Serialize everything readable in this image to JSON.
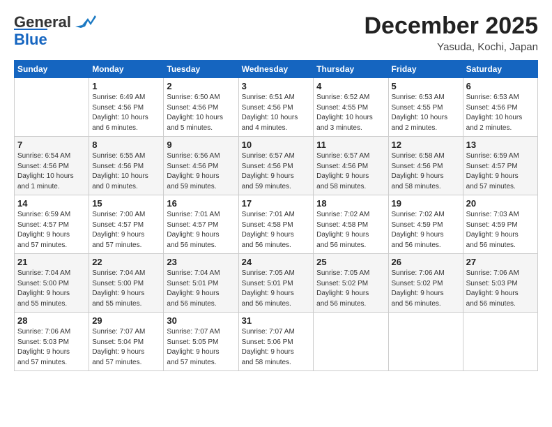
{
  "logo": {
    "line1": "General",
    "line2": "Blue"
  },
  "header": {
    "month": "December 2025",
    "location": "Yasuda, Kochi, Japan"
  },
  "weekdays": [
    "Sunday",
    "Monday",
    "Tuesday",
    "Wednesday",
    "Thursday",
    "Friday",
    "Saturday"
  ],
  "weeks": [
    [
      {
        "day": "",
        "info": ""
      },
      {
        "day": "1",
        "info": "Sunrise: 6:49 AM\nSunset: 4:56 PM\nDaylight: 10 hours\nand 6 minutes."
      },
      {
        "day": "2",
        "info": "Sunrise: 6:50 AM\nSunset: 4:56 PM\nDaylight: 10 hours\nand 5 minutes."
      },
      {
        "day": "3",
        "info": "Sunrise: 6:51 AM\nSunset: 4:56 PM\nDaylight: 10 hours\nand 4 minutes."
      },
      {
        "day": "4",
        "info": "Sunrise: 6:52 AM\nSunset: 4:55 PM\nDaylight: 10 hours\nand 3 minutes."
      },
      {
        "day": "5",
        "info": "Sunrise: 6:53 AM\nSunset: 4:55 PM\nDaylight: 10 hours\nand 2 minutes."
      },
      {
        "day": "6",
        "info": "Sunrise: 6:53 AM\nSunset: 4:56 PM\nDaylight: 10 hours\nand 2 minutes."
      }
    ],
    [
      {
        "day": "7",
        "info": "Sunrise: 6:54 AM\nSunset: 4:56 PM\nDaylight: 10 hours\nand 1 minute."
      },
      {
        "day": "8",
        "info": "Sunrise: 6:55 AM\nSunset: 4:56 PM\nDaylight: 10 hours\nand 0 minutes."
      },
      {
        "day": "9",
        "info": "Sunrise: 6:56 AM\nSunset: 4:56 PM\nDaylight: 9 hours\nand 59 minutes."
      },
      {
        "day": "10",
        "info": "Sunrise: 6:57 AM\nSunset: 4:56 PM\nDaylight: 9 hours\nand 59 minutes."
      },
      {
        "day": "11",
        "info": "Sunrise: 6:57 AM\nSunset: 4:56 PM\nDaylight: 9 hours\nand 58 minutes."
      },
      {
        "day": "12",
        "info": "Sunrise: 6:58 AM\nSunset: 4:56 PM\nDaylight: 9 hours\nand 58 minutes."
      },
      {
        "day": "13",
        "info": "Sunrise: 6:59 AM\nSunset: 4:57 PM\nDaylight: 9 hours\nand 57 minutes."
      }
    ],
    [
      {
        "day": "14",
        "info": "Sunrise: 6:59 AM\nSunset: 4:57 PM\nDaylight: 9 hours\nand 57 minutes."
      },
      {
        "day": "15",
        "info": "Sunrise: 7:00 AM\nSunset: 4:57 PM\nDaylight: 9 hours\nand 57 minutes."
      },
      {
        "day": "16",
        "info": "Sunrise: 7:01 AM\nSunset: 4:57 PM\nDaylight: 9 hours\nand 56 minutes."
      },
      {
        "day": "17",
        "info": "Sunrise: 7:01 AM\nSunset: 4:58 PM\nDaylight: 9 hours\nand 56 minutes."
      },
      {
        "day": "18",
        "info": "Sunrise: 7:02 AM\nSunset: 4:58 PM\nDaylight: 9 hours\nand 56 minutes."
      },
      {
        "day": "19",
        "info": "Sunrise: 7:02 AM\nSunset: 4:59 PM\nDaylight: 9 hours\nand 56 minutes."
      },
      {
        "day": "20",
        "info": "Sunrise: 7:03 AM\nSunset: 4:59 PM\nDaylight: 9 hours\nand 56 minutes."
      }
    ],
    [
      {
        "day": "21",
        "info": "Sunrise: 7:04 AM\nSunset: 5:00 PM\nDaylight: 9 hours\nand 55 minutes."
      },
      {
        "day": "22",
        "info": "Sunrise: 7:04 AM\nSunset: 5:00 PM\nDaylight: 9 hours\nand 55 minutes."
      },
      {
        "day": "23",
        "info": "Sunrise: 7:04 AM\nSunset: 5:01 PM\nDaylight: 9 hours\nand 56 minutes."
      },
      {
        "day": "24",
        "info": "Sunrise: 7:05 AM\nSunset: 5:01 PM\nDaylight: 9 hours\nand 56 minutes."
      },
      {
        "day": "25",
        "info": "Sunrise: 7:05 AM\nSunset: 5:02 PM\nDaylight: 9 hours\nand 56 minutes."
      },
      {
        "day": "26",
        "info": "Sunrise: 7:06 AM\nSunset: 5:02 PM\nDaylight: 9 hours\nand 56 minutes."
      },
      {
        "day": "27",
        "info": "Sunrise: 7:06 AM\nSunset: 5:03 PM\nDaylight: 9 hours\nand 56 minutes."
      }
    ],
    [
      {
        "day": "28",
        "info": "Sunrise: 7:06 AM\nSunset: 5:03 PM\nDaylight: 9 hours\nand 57 minutes."
      },
      {
        "day": "29",
        "info": "Sunrise: 7:07 AM\nSunset: 5:04 PM\nDaylight: 9 hours\nand 57 minutes."
      },
      {
        "day": "30",
        "info": "Sunrise: 7:07 AM\nSunset: 5:05 PM\nDaylight: 9 hours\nand 57 minutes."
      },
      {
        "day": "31",
        "info": "Sunrise: 7:07 AM\nSunset: 5:06 PM\nDaylight: 9 hours\nand 58 minutes."
      },
      {
        "day": "",
        "info": ""
      },
      {
        "day": "",
        "info": ""
      },
      {
        "day": "",
        "info": ""
      }
    ]
  ]
}
